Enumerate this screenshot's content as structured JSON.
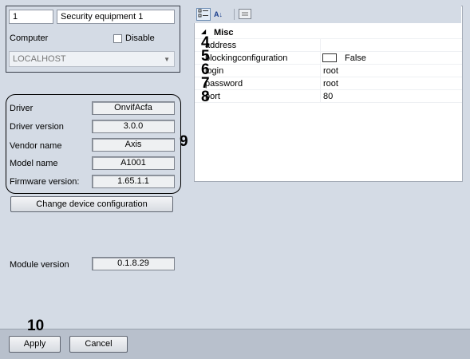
{
  "object": {
    "id_value": "1",
    "name_value": "Security equipment 1",
    "computer_label": "Computer",
    "disable_label": "Disable",
    "computer_value": "LOCALHOST"
  },
  "info": {
    "rows": [
      {
        "label": "Driver",
        "value": "OnvifAcfa"
      },
      {
        "label": "Driver version",
        "value": "3.0.0"
      },
      {
        "label": "Vendor name",
        "value": "Axis"
      },
      {
        "label": "Model name",
        "value": "A1001"
      },
      {
        "label": "Firmware version:",
        "value": "1.65.1.1"
      }
    ],
    "change_config_button": "Change device configuration",
    "module_version_label": "Module version",
    "module_version_value": "0.1.8.29"
  },
  "property_grid": {
    "category": "Misc",
    "collapse_glyph": "◢",
    "sort_az_glyph": "A↓",
    "properties": [
      {
        "name": "address",
        "value": ""
      },
      {
        "name": "blockingconfiguration",
        "value": "False"
      },
      {
        "name": "login",
        "value": "root"
      },
      {
        "name": "password",
        "value": "root"
      },
      {
        "name": "port",
        "value": "80"
      }
    ]
  },
  "callouts": {
    "n4": "4",
    "n5": "5",
    "n6": "6",
    "n7": "7",
    "n8": "8",
    "n9": "9",
    "n10": "10"
  },
  "footer": {
    "apply_label": "Apply",
    "cancel_label": "Cancel"
  }
}
